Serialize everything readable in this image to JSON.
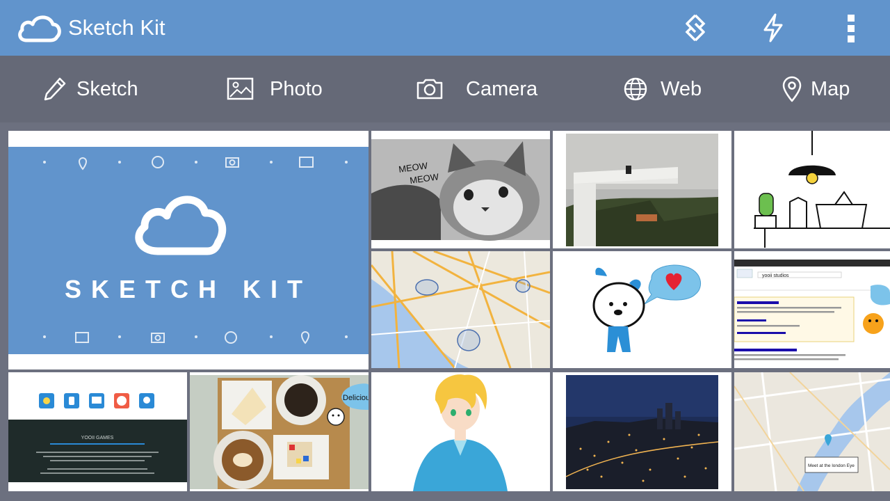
{
  "app": {
    "title": "Sketch Kit"
  },
  "appbar": {
    "icons": [
      "cloud-logo-icon",
      "shortcut-icon",
      "lightning-icon",
      "overflow-menu-icon"
    ]
  },
  "toolbar": {
    "items": [
      {
        "label": "Sketch",
        "icon": "pencil-icon"
      },
      {
        "label": "Photo",
        "icon": "image-icon"
      },
      {
        "label": "Camera",
        "icon": "camera-icon"
      },
      {
        "label": "Web",
        "icon": "globe-icon"
      },
      {
        "label": "Map",
        "icon": "map-pin-icon"
      }
    ]
  },
  "gallery": {
    "hero_title": "SKETCH KIT",
    "cat_caption": "MEOW\nMEOW",
    "cafe_bubble": "Delicious",
    "web_result_title": "yooii studios",
    "map_bubble": "Meet at the london Eye",
    "promo_heading": "YOOII GAMES"
  },
  "colors": {
    "appbar": "#6194cc",
    "toolbar": "#656977",
    "grid_bg": "#6c707f",
    "hero_blue": "#6194cc"
  }
}
